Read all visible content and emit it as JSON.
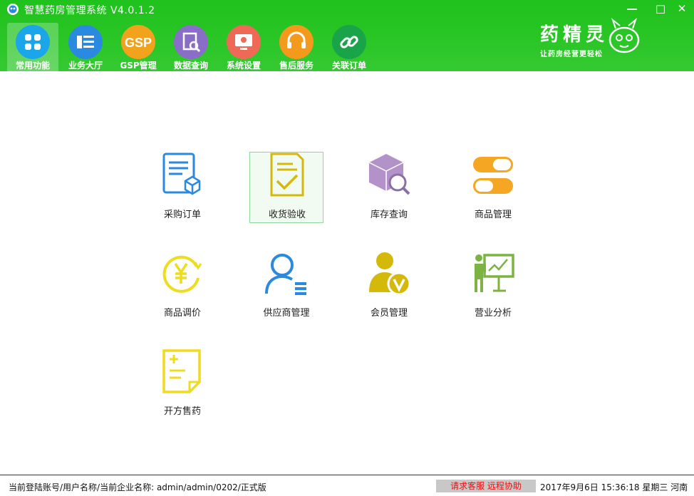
{
  "window": {
    "title": "智慧药房管理系统 V4.0.1.2",
    "minimize": "—",
    "maximize": "□",
    "close": "✕"
  },
  "nav": [
    {
      "label": "常用功能",
      "icon": "apps-icon",
      "color": "#1aa6e8",
      "active": true
    },
    {
      "label": "业务大厅",
      "icon": "list-icon",
      "color": "#2a8ae0"
    },
    {
      "label": "GSP管理",
      "icon": "gsp-icon",
      "color": "#f2a21b"
    },
    {
      "label": "数据查询",
      "icon": "search-doc-icon",
      "color": "#8a6cc9"
    },
    {
      "label": "系统设置",
      "icon": "settings-icon",
      "color": "#ee6a57"
    },
    {
      "label": "售后服务",
      "icon": "headset-icon",
      "color": "#f39a1c"
    },
    {
      "label": "关联订单",
      "icon": "link-icon",
      "color": "#1aa44a"
    }
  ],
  "brand": {
    "name": "药精灵",
    "slogan": "让药房经营更轻松"
  },
  "tiles": [
    {
      "label": "采购订单",
      "icon": "purchase-order-icon"
    },
    {
      "label": "收货验收",
      "icon": "receive-check-icon"
    },
    {
      "label": "库存查询",
      "icon": "inventory-search-icon"
    },
    {
      "label": "商品管理",
      "icon": "pill-icon"
    },
    {
      "label": "商品调价",
      "icon": "price-adjust-icon"
    },
    {
      "label": "供应商管理",
      "icon": "supplier-icon"
    },
    {
      "label": "会员管理",
      "icon": "member-icon"
    },
    {
      "label": "营业分析",
      "icon": "analysis-icon"
    },
    {
      "label": "开方售药",
      "icon": "prescription-icon"
    }
  ],
  "status": {
    "left": "当前登陆账号/用户名称/当前企业名称: admin/admin/0202/正式版",
    "remote": "请求客服 远程协助",
    "right": "2017年9月6日 15:36:18 星期三 河南"
  }
}
